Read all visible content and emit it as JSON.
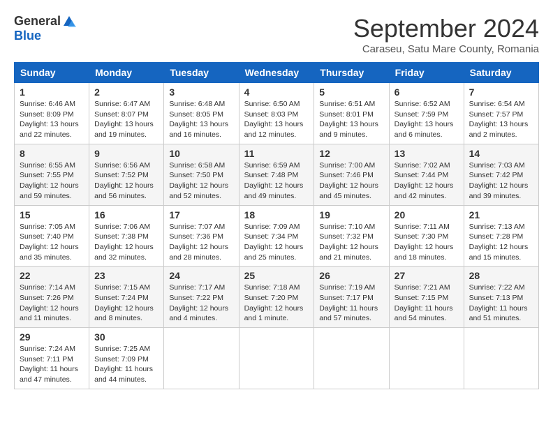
{
  "logo": {
    "general": "General",
    "blue": "Blue"
  },
  "title": "September 2024",
  "location": "Caraseu, Satu Mare County, Romania",
  "days_header": [
    "Sunday",
    "Monday",
    "Tuesday",
    "Wednesday",
    "Thursday",
    "Friday",
    "Saturday"
  ],
  "weeks": [
    [
      {
        "day": "1",
        "info": "Sunrise: 6:46 AM\nSunset: 8:09 PM\nDaylight: 13 hours\nand 22 minutes."
      },
      {
        "day": "2",
        "info": "Sunrise: 6:47 AM\nSunset: 8:07 PM\nDaylight: 13 hours\nand 19 minutes."
      },
      {
        "day": "3",
        "info": "Sunrise: 6:48 AM\nSunset: 8:05 PM\nDaylight: 13 hours\nand 16 minutes."
      },
      {
        "day": "4",
        "info": "Sunrise: 6:50 AM\nSunset: 8:03 PM\nDaylight: 13 hours\nand 12 minutes."
      },
      {
        "day": "5",
        "info": "Sunrise: 6:51 AM\nSunset: 8:01 PM\nDaylight: 13 hours\nand 9 minutes."
      },
      {
        "day": "6",
        "info": "Sunrise: 6:52 AM\nSunset: 7:59 PM\nDaylight: 13 hours\nand 6 minutes."
      },
      {
        "day": "7",
        "info": "Sunrise: 6:54 AM\nSunset: 7:57 PM\nDaylight: 13 hours\nand 2 minutes."
      }
    ],
    [
      {
        "day": "8",
        "info": "Sunrise: 6:55 AM\nSunset: 7:55 PM\nDaylight: 12 hours\nand 59 minutes."
      },
      {
        "day": "9",
        "info": "Sunrise: 6:56 AM\nSunset: 7:52 PM\nDaylight: 12 hours\nand 56 minutes."
      },
      {
        "day": "10",
        "info": "Sunrise: 6:58 AM\nSunset: 7:50 PM\nDaylight: 12 hours\nand 52 minutes."
      },
      {
        "day": "11",
        "info": "Sunrise: 6:59 AM\nSunset: 7:48 PM\nDaylight: 12 hours\nand 49 minutes."
      },
      {
        "day": "12",
        "info": "Sunrise: 7:00 AM\nSunset: 7:46 PM\nDaylight: 12 hours\nand 45 minutes."
      },
      {
        "day": "13",
        "info": "Sunrise: 7:02 AM\nSunset: 7:44 PM\nDaylight: 12 hours\nand 42 minutes."
      },
      {
        "day": "14",
        "info": "Sunrise: 7:03 AM\nSunset: 7:42 PM\nDaylight: 12 hours\nand 39 minutes."
      }
    ],
    [
      {
        "day": "15",
        "info": "Sunrise: 7:05 AM\nSunset: 7:40 PM\nDaylight: 12 hours\nand 35 minutes."
      },
      {
        "day": "16",
        "info": "Sunrise: 7:06 AM\nSunset: 7:38 PM\nDaylight: 12 hours\nand 32 minutes."
      },
      {
        "day": "17",
        "info": "Sunrise: 7:07 AM\nSunset: 7:36 PM\nDaylight: 12 hours\nand 28 minutes."
      },
      {
        "day": "18",
        "info": "Sunrise: 7:09 AM\nSunset: 7:34 PM\nDaylight: 12 hours\nand 25 minutes."
      },
      {
        "day": "19",
        "info": "Sunrise: 7:10 AM\nSunset: 7:32 PM\nDaylight: 12 hours\nand 21 minutes."
      },
      {
        "day": "20",
        "info": "Sunrise: 7:11 AM\nSunset: 7:30 PM\nDaylight: 12 hours\nand 18 minutes."
      },
      {
        "day": "21",
        "info": "Sunrise: 7:13 AM\nSunset: 7:28 PM\nDaylight: 12 hours\nand 15 minutes."
      }
    ],
    [
      {
        "day": "22",
        "info": "Sunrise: 7:14 AM\nSunset: 7:26 PM\nDaylight: 12 hours\nand 11 minutes."
      },
      {
        "day": "23",
        "info": "Sunrise: 7:15 AM\nSunset: 7:24 PM\nDaylight: 12 hours\nand 8 minutes."
      },
      {
        "day": "24",
        "info": "Sunrise: 7:17 AM\nSunset: 7:22 PM\nDaylight: 12 hours\nand 4 minutes."
      },
      {
        "day": "25",
        "info": "Sunrise: 7:18 AM\nSunset: 7:20 PM\nDaylight: 12 hours\nand 1 minute."
      },
      {
        "day": "26",
        "info": "Sunrise: 7:19 AM\nSunset: 7:17 PM\nDaylight: 11 hours\nand 57 minutes."
      },
      {
        "day": "27",
        "info": "Sunrise: 7:21 AM\nSunset: 7:15 PM\nDaylight: 11 hours\nand 54 minutes."
      },
      {
        "day": "28",
        "info": "Sunrise: 7:22 AM\nSunset: 7:13 PM\nDaylight: 11 hours\nand 51 minutes."
      }
    ],
    [
      {
        "day": "29",
        "info": "Sunrise: 7:24 AM\nSunset: 7:11 PM\nDaylight: 11 hours\nand 47 minutes."
      },
      {
        "day": "30",
        "info": "Sunrise: 7:25 AM\nSunset: 7:09 PM\nDaylight: 11 hours\nand 44 minutes."
      },
      {
        "day": "",
        "info": ""
      },
      {
        "day": "",
        "info": ""
      },
      {
        "day": "",
        "info": ""
      },
      {
        "day": "",
        "info": ""
      },
      {
        "day": "",
        "info": ""
      }
    ]
  ]
}
